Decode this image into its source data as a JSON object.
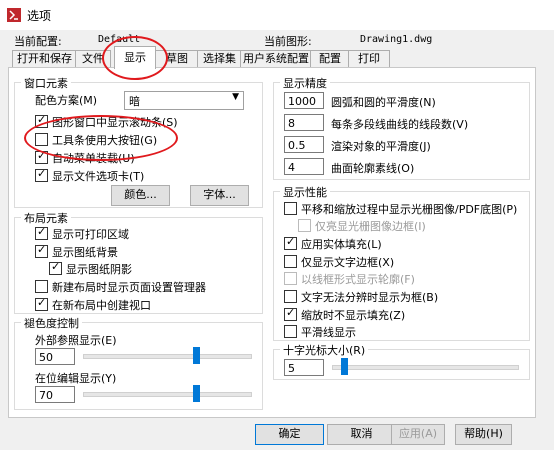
{
  "window": {
    "title": "选项"
  },
  "header": {
    "profile_label": "当前配置:",
    "profile_value": "Default",
    "drawing_label": "当前图形:",
    "drawing_value": "Drawing1.dwg"
  },
  "tabs": [
    {
      "label": "打开和保存"
    },
    {
      "label": "文件"
    },
    {
      "label": "显示"
    },
    {
      "label": "草图"
    },
    {
      "label": "选择集"
    },
    {
      "label": "用户系统配置"
    },
    {
      "label": "配置"
    },
    {
      "label": "打印"
    }
  ],
  "window_elements": {
    "title": "窗口元素",
    "color_scheme_label": "配色方案(M)",
    "color_scheme_value": "暗",
    "checks": [
      {
        "label": "图形窗口中显示滚动条(S)",
        "checked": true
      },
      {
        "label": "工具条使用大按钮(G)",
        "checked": false
      },
      {
        "label": "自动菜单装载(U)",
        "checked": true
      },
      {
        "label": "显示文件选项卡(T)",
        "checked": true
      }
    ],
    "colors_button": "颜色...",
    "fonts_button": "字体..."
  },
  "layout_elements": {
    "title": "布局元素",
    "checks": [
      {
        "label": "显示可打印区域",
        "checked": true
      },
      {
        "label": "显示图纸背景",
        "checked": true
      },
      {
        "label": "显示图纸阴影",
        "checked": true
      },
      {
        "label": "新建布局时显示页面设置管理器",
        "checked": false
      },
      {
        "label": "在新布局中创建视口",
        "checked": true
      }
    ]
  },
  "fade_control": {
    "title": "褪色度控制",
    "xref_label": "外部参照显示(E)",
    "xref_value": "50",
    "xref_level": 50,
    "inplace_label": "在位编辑显示(Y)",
    "inplace_value": "70",
    "inplace_level": 70
  },
  "display_precision": {
    "title": "显示精度",
    "rows": [
      {
        "value": "1000",
        "label": "圆弧和圆的平滑度(N)"
      },
      {
        "value": "8",
        "label": "每条多段线曲线的线段数(V)"
      },
      {
        "value": "0.5",
        "label": "渲染对象的平滑度(J)"
      },
      {
        "value": "4",
        "label": "曲面轮廓素线(O)"
      }
    ]
  },
  "display_performance": {
    "title": "显示性能",
    "checks": [
      {
        "label": "平移和缩放过程中显示光栅图像/PDF底图(P)",
        "checked": false,
        "disabled": false
      },
      {
        "label": "仅亮显光栅图像边框(I)",
        "checked": false,
        "disabled": true
      },
      {
        "label": "应用实体填充(L)",
        "checked": true,
        "disabled": false
      },
      {
        "label": "仅显示文字边框(X)",
        "checked": false,
        "disabled": false
      },
      {
        "label": "以线框形式显示轮廓(F)",
        "checked": false,
        "disabled": true
      },
      {
        "label": "文字无法分辨时显示为框(B)",
        "checked": false,
        "disabled": false
      },
      {
        "label": "缩放时不显示填充(Z)",
        "checked": true,
        "disabled": false
      },
      {
        "label": "平滑线显示",
        "checked": false,
        "disabled": false
      }
    ]
  },
  "crosshair": {
    "title": "十字光标大小(R)",
    "value": "5",
    "level": 5
  },
  "buttons": {
    "ok": "确定",
    "cancel": "取消",
    "apply": "应用(A)",
    "help": "帮助(H)"
  },
  "colors": {
    "accent": "#0078d7",
    "annotation": "#e0191d"
  }
}
